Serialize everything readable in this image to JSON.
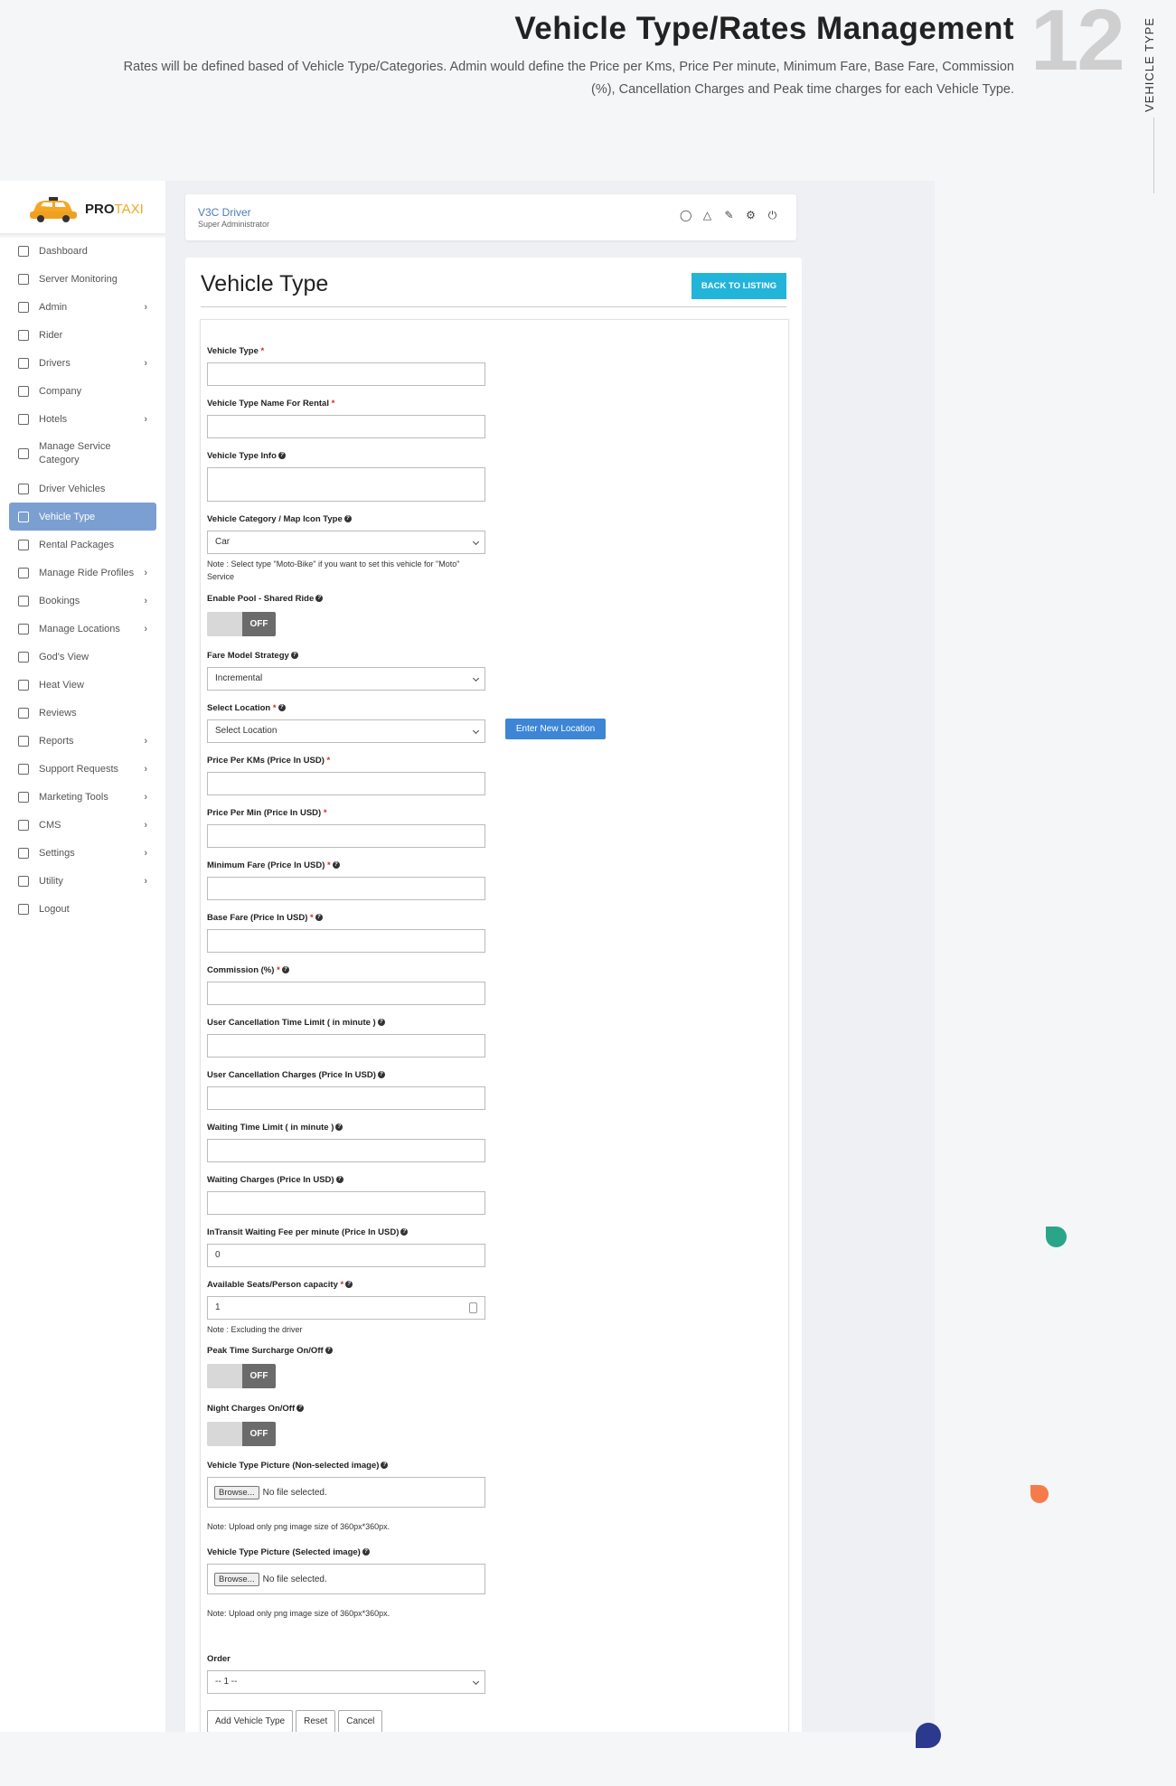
{
  "header": {
    "title": "Vehicle Type/Rates Management",
    "description": "Rates will be defined based of Vehicle Type/Categories. Admin would define the Price per Kms, Price Per minute, Minimum Fare, Base Fare, Commission (%), Cancellation Charges and Peak time charges for each Vehicle Type.",
    "number": "12",
    "side_label": "VEHICLE TYPE"
  },
  "logo": {
    "brand_pro": "PRO",
    "brand_taxi": "TAXI"
  },
  "sidebar": {
    "items": [
      {
        "label": "Dashboard"
      },
      {
        "label": "Server Monitoring"
      },
      {
        "label": "Admin"
      },
      {
        "label": "Rider"
      },
      {
        "label": "Drivers"
      },
      {
        "label": "Company"
      },
      {
        "label": "Hotels"
      },
      {
        "label": "Manage Service Category"
      },
      {
        "label": "Driver Vehicles"
      },
      {
        "label": "Vehicle Type"
      },
      {
        "label": "Rental Packages"
      },
      {
        "label": "Manage Ride Profiles"
      },
      {
        "label": "Bookings"
      },
      {
        "label": "Manage Locations"
      },
      {
        "label": "God's View"
      },
      {
        "label": "Heat View"
      },
      {
        "label": "Reviews"
      },
      {
        "label": "Reports"
      },
      {
        "label": "Support Requests"
      },
      {
        "label": "Marketing Tools"
      },
      {
        "label": "CMS"
      },
      {
        "label": "Settings"
      },
      {
        "label": "Utility"
      },
      {
        "label": "Logout"
      }
    ],
    "chevron": "›"
  },
  "topbar": {
    "name": "V3C Driver",
    "role": "Super Administrator",
    "icons": [
      "user-icon",
      "alert-icon",
      "edit-icon",
      "settings-icon",
      "power-icon"
    ]
  },
  "page": {
    "title": "Vehicle Type",
    "back_button": "BACK TO LISTING"
  },
  "form": {
    "vehicle_type": "Vehicle Type",
    "vehicle_type_rental": "Vehicle Type Name For Rental",
    "vehicle_type_info": "Vehicle Type Info",
    "category_label": "Vehicle Category / Map Icon Type",
    "category_value": "Car",
    "category_note": "Note : Select type \"Moto-Bike\" if you want to set this vehicle for \"Moto\" Service",
    "pool_label": "Enable Pool - Shared Ride",
    "toggle_off": "OFF",
    "fare_label": "Fare Model Strategy",
    "fare_value": "Incremental",
    "location_label": "Select Location",
    "location_value": "Select Location",
    "location_button": "Enter New Location",
    "price_km": "Price Per KMs (Price In USD)",
    "price_min": "Price Per Min (Price In USD)",
    "min_fare": "Minimum Fare (Price In USD)",
    "base_fare": "Base Fare (Price In USD)",
    "commission": "Commission (%)",
    "cancel_time": "User Cancellation Time Limit ( in minute )",
    "cancel_charges": "User Cancellation Charges (Price In USD)",
    "waiting_time": "Waiting Time Limit ( in minute )",
    "waiting_charges": "Waiting Charges (Price In USD)",
    "intransit_label": "InTransit Waiting Fee per minute (Price In USD)",
    "intransit_value": "0",
    "seats_label": "Available Seats/Person capacity",
    "seats_value": "1",
    "seats_note": "Note : Excluding the driver",
    "peak_label": "Peak Time Surcharge On/Off",
    "night_label": "Night Charges On/Off",
    "pic1_label": "Vehicle Type Picture (Non-selected image)",
    "pic2_label": "Vehicle Type Picture (Selected image)",
    "browse": "Browse...",
    "no_file": "No file selected.",
    "upload_note": "Note: Upload only png image size of 360px*360px.",
    "order_label": "Order",
    "order_value": "-- 1 --",
    "add_button": "Add Vehicle Type",
    "reset_button": "Reset",
    "cancel_button": "Cancel"
  },
  "colors": {
    "accent": "#23b4d9",
    "active_nav": "#7b9fd1",
    "location_btn": "#3d86d6",
    "logo": "#f5a623"
  }
}
